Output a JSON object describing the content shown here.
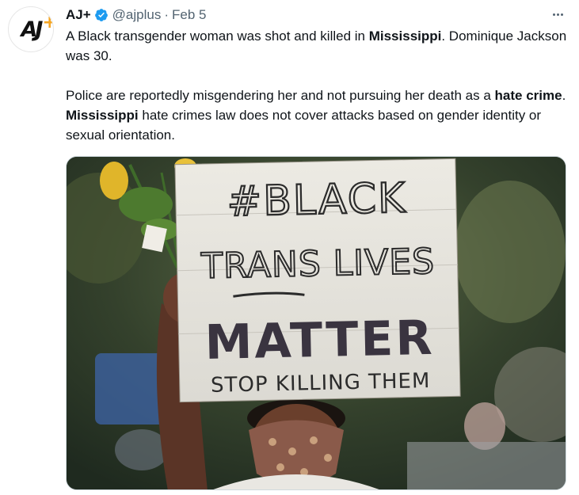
{
  "tweet": {
    "display_name": "AJ+",
    "handle": "@ajplus",
    "separator": "·",
    "date": "Feb 5",
    "avatar_text": "AJ",
    "avatar_plus": "+",
    "verified_icon": "verified-badge-icon",
    "body": {
      "p1_a": "A Black transgender woman was shot and killed in ",
      "p1_b": "Mississippi",
      "p1_c": ". Dominique Jackson was 30.",
      "p2_a": "Police are reportedly misgendering her and not pursuing her death as a ",
      "p2_b": "hate crime",
      "p2_c": ". ",
      "p2_d": "Mississippi",
      "p2_e": " hate crimes law does not cover attacks based on gender identity or sexual orientation."
    },
    "media": {
      "sign_line1": "#BLACK",
      "sign_line2": "TRANS LIVES",
      "sign_line3": "MATTER",
      "sign_line4": "STOP KILLING THEM"
    }
  },
  "colors": {
    "text": "#0f1419",
    "secondary": "#536471",
    "verified": "#1d9bf0",
    "border": "#cfd9de"
  }
}
